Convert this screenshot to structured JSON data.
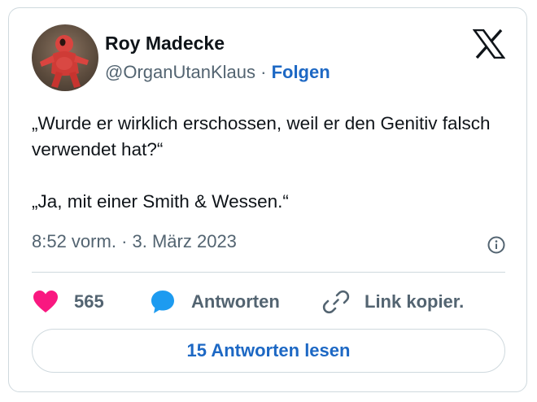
{
  "author": {
    "name": "Roy Madecke",
    "handle": "@OrganUtanKlaus",
    "separator": "·",
    "follow_label": "Folgen",
    "avatar_icon": "red-plush-figure-avatar"
  },
  "tweet": {
    "text": "„Wurde er wirklich erschossen, weil er den Genitiv falsch verwendet hat?“\n\n„Ja, mit einer Smith & Wessen.“",
    "time": "8:52 vorm.",
    "separator": "·",
    "date": "3. März 2023"
  },
  "actions": {
    "like_count": "565",
    "reply_label": "Antworten",
    "copy_label": "Link kopier."
  },
  "read_replies_label": "15 Antworten lesen",
  "icons": {
    "logo": "x-logo-icon",
    "info": "info-icon",
    "like": "heart-icon",
    "reply": "speech-bubble-icon",
    "copy": "link-icon"
  },
  "colors": {
    "accent": "#1d68c4",
    "like": "#f91880",
    "muted": "#536471",
    "border": "#cfd9de"
  }
}
